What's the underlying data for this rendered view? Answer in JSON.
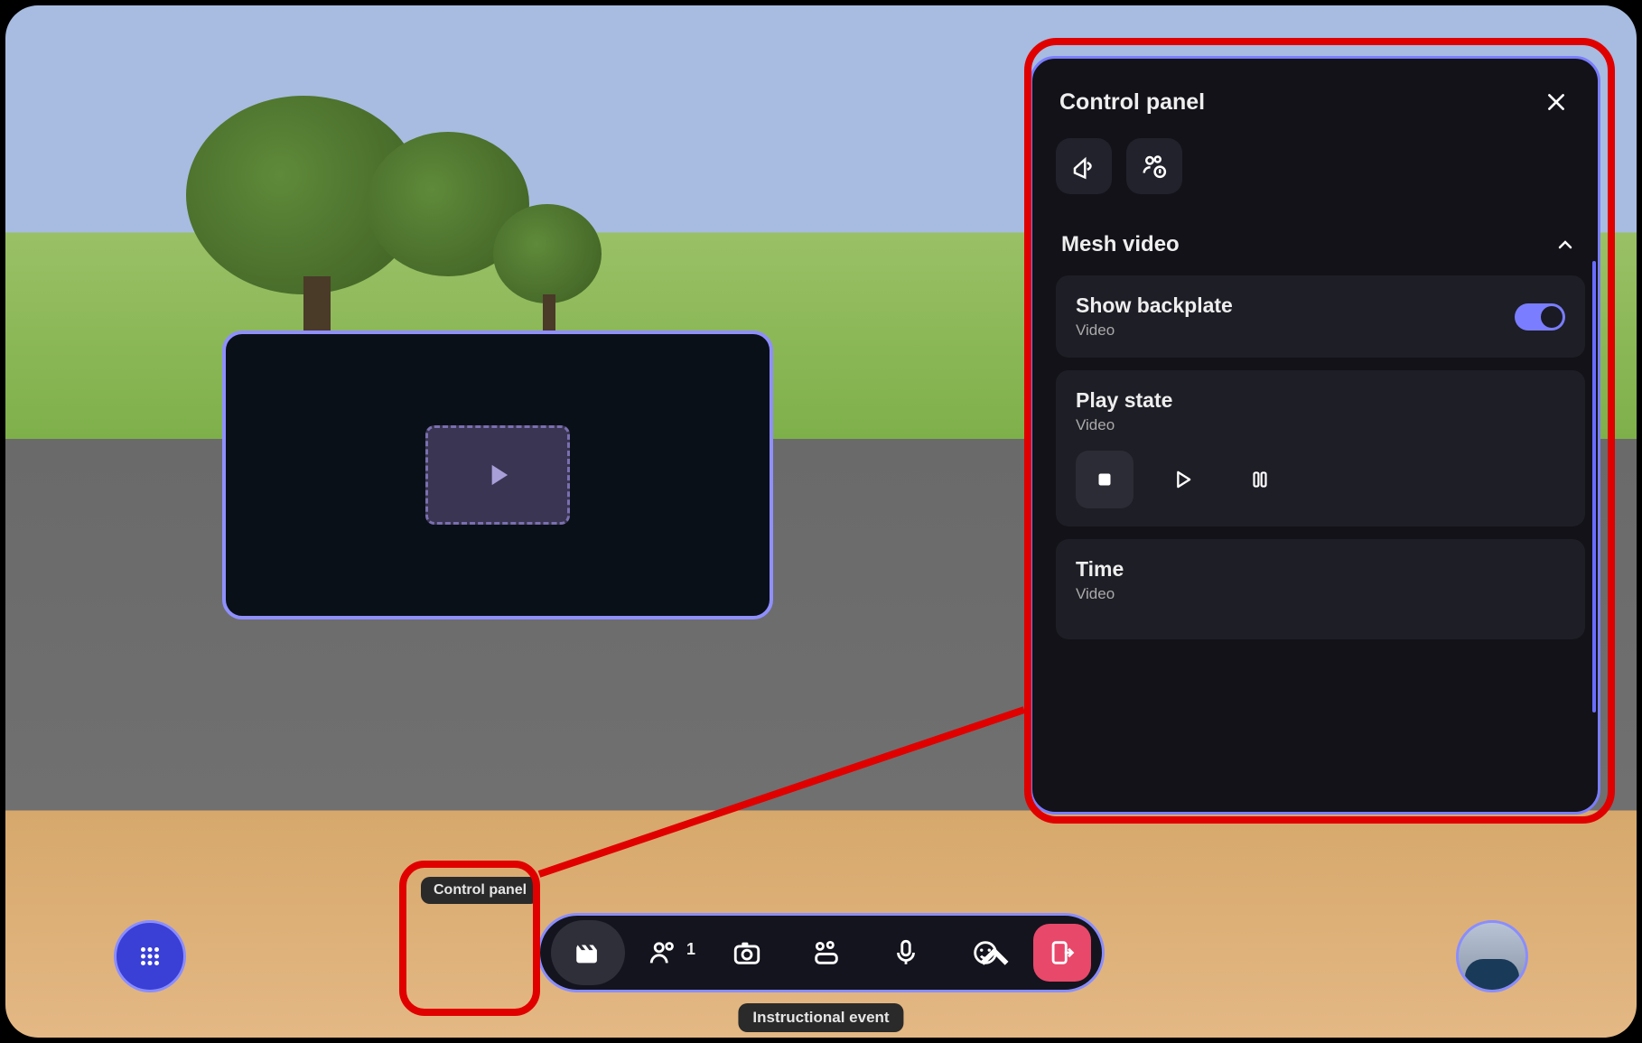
{
  "tooltip": {
    "control_panel": "Control panel"
  },
  "bottom_label": "Instructional event",
  "toolbar": {
    "participants_count": "1"
  },
  "control_panel": {
    "title": "Control panel",
    "sections": {
      "mesh_video": {
        "title": "Mesh video",
        "backplate": {
          "title": "Show backplate",
          "sub": "Video",
          "on": true
        },
        "play_state": {
          "title": "Play state",
          "sub": "Video",
          "selected": "stop"
        },
        "time": {
          "title": "Time",
          "sub": "Video"
        }
      }
    }
  }
}
